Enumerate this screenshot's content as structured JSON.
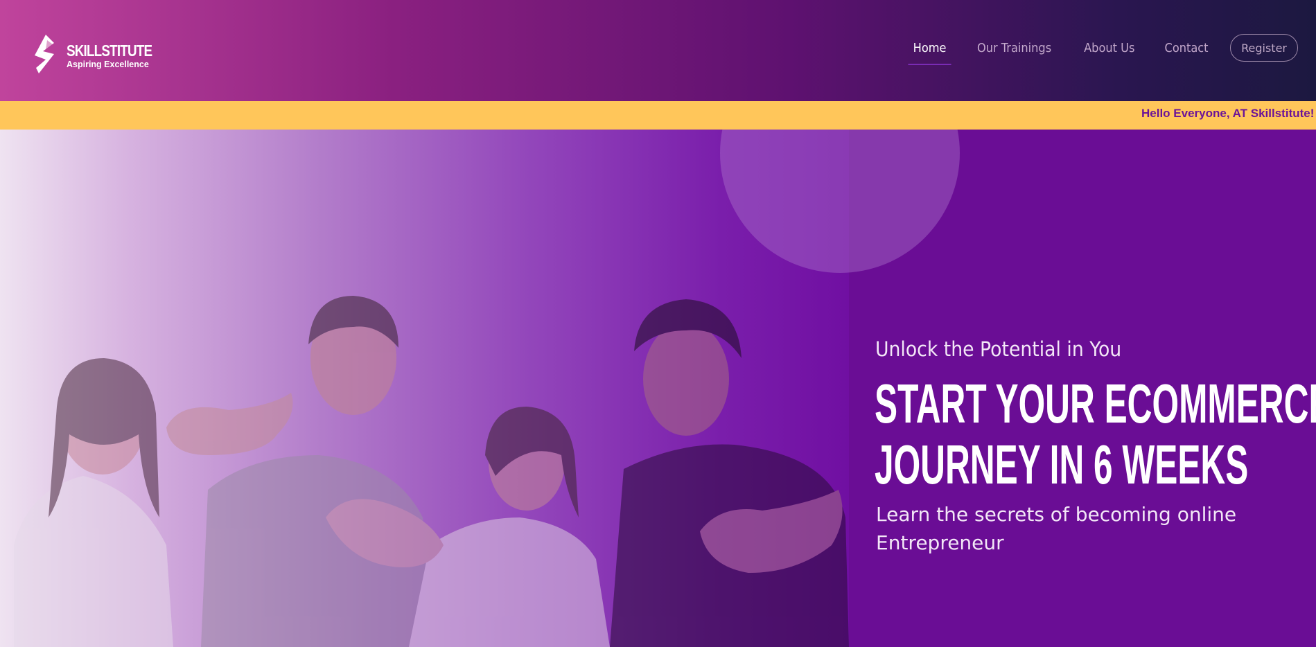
{
  "brand": {
    "name": "SKILLSTITUTE",
    "tagline": "Aspiring Excellence"
  },
  "nav": {
    "items": [
      {
        "label": "Home",
        "active": true
      },
      {
        "label": "Our Trainings",
        "active": false
      },
      {
        "label": "About Us",
        "active": false
      },
      {
        "label": "Contact",
        "active": false
      }
    ],
    "register_label": "Register"
  },
  "ticker": {
    "text": "Hello Everyone, AT Skillstitute! W"
  },
  "hero": {
    "subtitle": "Unlock the Potential in You",
    "title_line1": "START YOUR ECOMMERCE",
    "title_line2": "JOURNEY IN 6 WEEKS",
    "description": "Learn the secrets of becoming online Entrepreneur"
  },
  "colors": {
    "accent_purple": "#6a0d95",
    "ticker_bg": "#ffc65a",
    "ticker_text": "#6b1398"
  },
  "icons": {
    "logo": "skillstitute-logo-mark"
  }
}
